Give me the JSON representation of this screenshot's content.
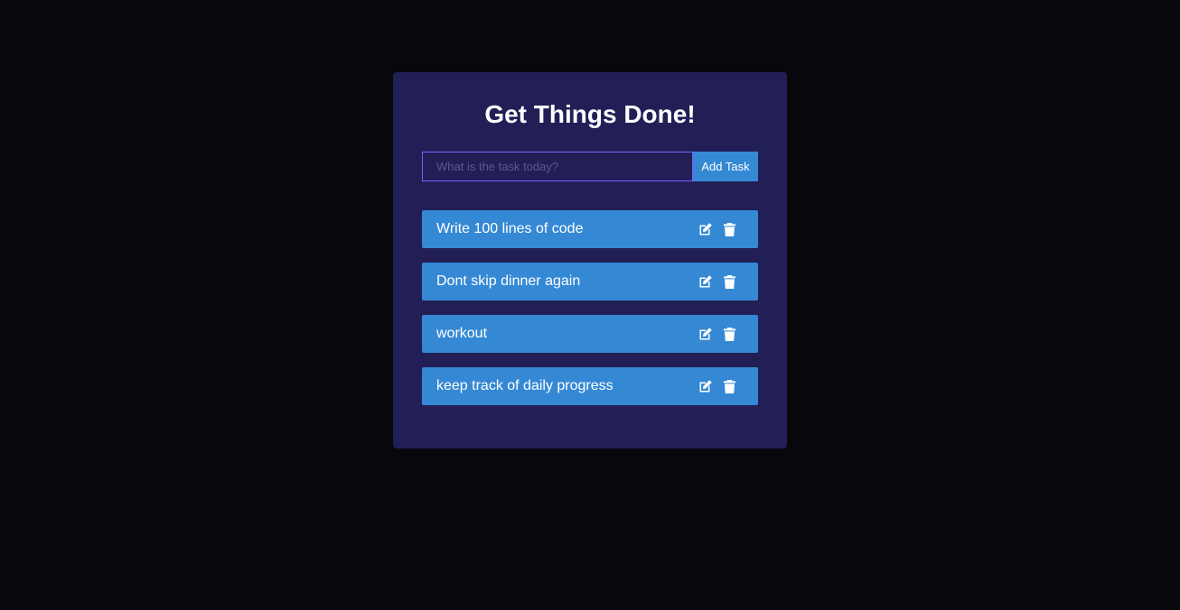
{
  "app": {
    "title": "Get Things Done!"
  },
  "form": {
    "placeholder": "What is the task today?",
    "input_value": "",
    "add_label": "Add Task"
  },
  "todos": [
    {
      "text": "Write 100 lines of code",
      "icons": [
        "edit-icon",
        "trash-icon"
      ]
    },
    {
      "text": "Dont skip dinner again",
      "icons": [
        "edit-icon",
        "trash-icon"
      ]
    },
    {
      "text": "workout",
      "icons": [
        "edit-icon",
        "trash-icon"
      ]
    },
    {
      "text": "keep track of daily progress",
      "icons": [
        "edit-icon",
        "trash-icon"
      ]
    }
  ],
  "colors": {
    "page_background": "#08070c",
    "card_background": "#221f57",
    "accent": "#3589d4",
    "input_border": "#8758ff",
    "text": "#ffffff"
  }
}
